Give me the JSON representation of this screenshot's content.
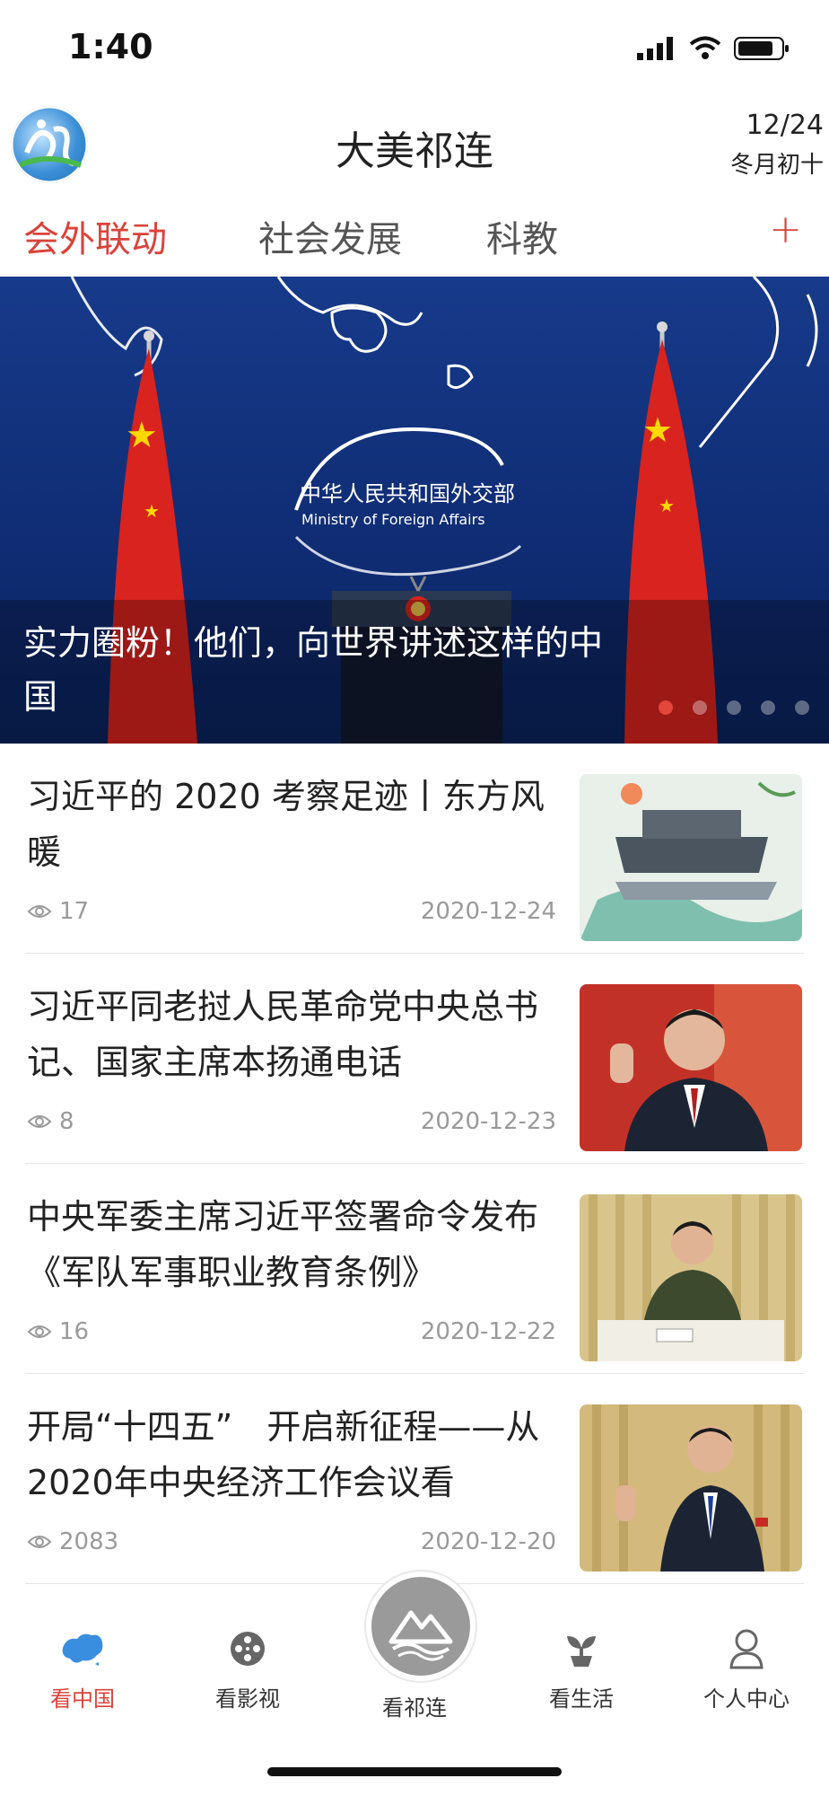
{
  "status_bar": {
    "time": "1:40"
  },
  "header": {
    "title": "大美祁连",
    "date": "12/24",
    "lunar_date": "冬月初十"
  },
  "tabs": [
    {
      "label": "会外联动",
      "active": true
    },
    {
      "label": "社会发展",
      "active": false
    },
    {
      "label": "科教",
      "active": false
    }
  ],
  "tab_add_label": "+",
  "banner": {
    "caption": "实力圈粉！他们，向世界讲述这样的中国",
    "emblem_text_cn": "中华人民共和国外交部",
    "emblem_text_en": "Ministry of Foreign Affairs",
    "dots_total": 5,
    "active_dot": 1
  },
  "news": [
    {
      "title": "习近平的 2020 考察足迹丨东方风暖",
      "views": "17",
      "date": "2020-12-24",
      "thumb": "landscape-illustration"
    },
    {
      "title": "习近平同老挝人民革命党中央总书记、国家主席本扬通电话",
      "views": "8",
      "date": "2020-12-23",
      "thumb": "portrait-red"
    },
    {
      "title": "中央军委主席习近平签署命令发布《军队军事职业教育条例》",
      "views": "16",
      "date": "2020-12-22",
      "thumb": "meeting-gold"
    },
    {
      "title": "开局“十四五”　开启新征程——从2020年中央经济工作会议看",
      "views": "2083",
      "date": "2020-12-20",
      "thumb": "speech-gold"
    }
  ],
  "bottom_nav": [
    {
      "label": "看中国",
      "icon": "china-map-icon",
      "active": true
    },
    {
      "label": "看影视",
      "icon": "film-reel-icon",
      "active": false
    },
    {
      "label": "看祁连",
      "icon": "mountain-icon",
      "active": false
    },
    {
      "label": "看生活",
      "icon": "sprout-icon",
      "active": false
    },
    {
      "label": "个人中心",
      "icon": "user-icon",
      "active": false
    }
  ],
  "colors": {
    "accent": "#d9433a",
    "meta": "#9a9a9a",
    "banner_bg": "#173a8a"
  }
}
